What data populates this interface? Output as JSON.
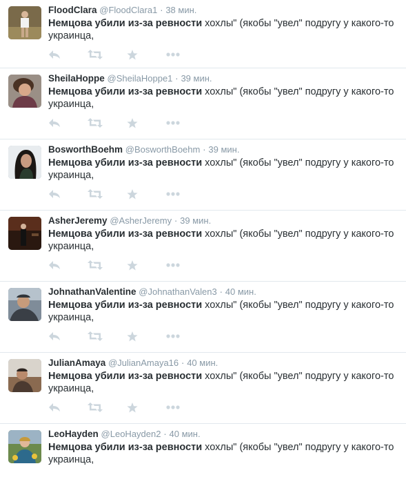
{
  "colors": {
    "name": "#292f33",
    "meta": "#8899a6",
    "icon": "#ccd6dd",
    "divider": "#e1e8ed"
  },
  "icons": {
    "reply": "reply-icon",
    "retweet": "retweet-icon",
    "favorite": "favorite-star-icon",
    "more": "more-dots-icon"
  },
  "tweets": [
    {
      "fullname": "FloodClara",
      "username": "@FloodClara1",
      "separator": "·",
      "time": "38 мин.",
      "text_bold": "Немцова убили из-за ревности",
      "text_rest": " хохлы\" (якобы \"увел\" подругу у какого-то украинца,"
    },
    {
      "fullname": "SheilaHoppe",
      "username": "@SheilaHoppe1",
      "separator": "·",
      "time": "39 мин.",
      "text_bold": "Немцова убили из-за ревности",
      "text_rest": " хохлы\" (якобы \"увел\" подругу у какого-то украинца,"
    },
    {
      "fullname": "BosworthBoehm",
      "username": "@BosworthBoehm",
      "separator": "·",
      "time": "39 мин.",
      "text_bold": "Немцова убили из-за ревности",
      "text_rest": " хохлы\" (якобы \"увел\" подругу у какого-то украинца,"
    },
    {
      "fullname": "AsherJeremy",
      "username": "@AsherJeremy",
      "separator": "·",
      "time": "39 мин.",
      "text_bold": "Немцова убили из-за ревности",
      "text_rest": " хохлы\" (якобы \"увел\" подругу у какого-то украинца,"
    },
    {
      "fullname": "JohnathanValentine",
      "username": "@JohnathanValen3",
      "separator": "·",
      "time": "40 мин.",
      "text_bold": "Немцова убили из-за ревности",
      "text_rest": " хохлы\" (якобы \"увел\" подругу у какого-то украинца,"
    },
    {
      "fullname": "JulianAmaya",
      "username": "@JulianAmaya16",
      "separator": "·",
      "time": "40 мин.",
      "text_bold": "Немцова убили из-за ревности",
      "text_rest": " хохлы\" (якобы \"увел\" подругу у какого-то украинца,"
    },
    {
      "fullname": "LeoHayden",
      "username": "@LeoHayden2",
      "separator": "·",
      "time": "40 мин.",
      "text_bold": "Немцова убили из-за ревности",
      "text_rest": " хохлы\" (якобы \"увел\" подругу у какого-то украинца,"
    }
  ]
}
